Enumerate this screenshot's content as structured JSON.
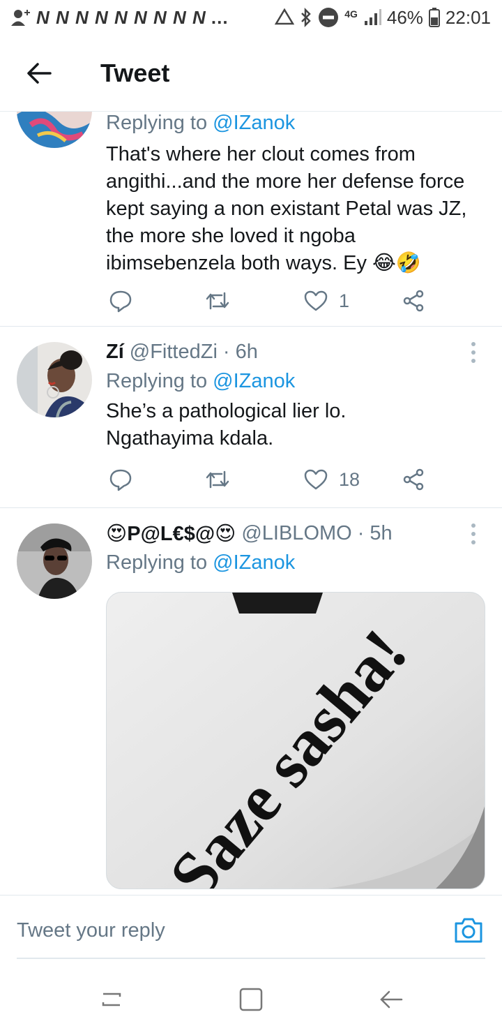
{
  "status_bar": {
    "notification_glyphs": "N N N N N N N N N",
    "more": "…",
    "battery": "46%",
    "time": "22:01",
    "network": "4G"
  },
  "app_bar": {
    "title": "Tweet"
  },
  "tweets": [
    {
      "reply_prefix": "Replying to",
      "reply_mention": "@IZanok",
      "text": "That's where her clout comes from\nangithi...and the more her defense force\nkept saying a non existant Petal was JZ,\nthe more she loved it ngoba\nibimsebenzela both ways.  Ey 😂🤣",
      "likes": "1"
    },
    {
      "name": "Zí",
      "handle": "@FittedZi",
      "time": "· 6h",
      "reply_prefix": "Replying to",
      "reply_mention": "@IZanok",
      "text": "She’s a pathological lier lo.\nNgathayima kdala.",
      "likes": "18"
    },
    {
      "name": "😍P@L€$@😍",
      "handle": "@LIBLOMO",
      "time": "· 5h",
      "reply_prefix": "Replying to",
      "reply_mention": "@IZanok",
      "media_text": "Saze sasha!"
    }
  ],
  "reply_bar": {
    "placeholder": "Tweet your reply"
  },
  "colors": {
    "accent": "#1b95e0",
    "muted": "#657786",
    "text": "#14171a",
    "divider": "#e1e8ed"
  },
  "icons": {
    "back": "arrow-left-icon",
    "reply": "reply-bubble-icon",
    "retweet": "retweet-icon",
    "like": "heart-icon",
    "share": "share-icon",
    "more": "more-vertical-icon",
    "camera": "camera-icon"
  }
}
